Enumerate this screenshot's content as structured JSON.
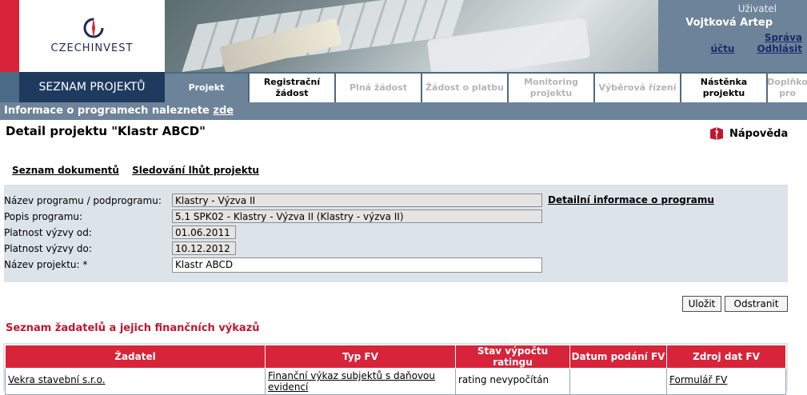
{
  "header": {
    "logo_text": "CZECHINVEST",
    "user_label": "Uživatel",
    "user_name": "Vojtková Artep",
    "account_link": "Správa účtu",
    "logout_link": "Odhlásit"
  },
  "nav": {
    "main": "SEZNAM PROJEKTŮ",
    "tabs": [
      {
        "label": "Projekt"
      },
      {
        "label": "Registrační žádost"
      },
      {
        "label": "Plná žádost"
      },
      {
        "label": "Žádost o platbu"
      },
      {
        "label": "Monitoring projektu"
      },
      {
        "label": "Výběrová řízení"
      },
      {
        "label": "Nástěnka projektu"
      },
      {
        "label": "Doplňko pro"
      }
    ]
  },
  "info_bar": {
    "text": "Informace o programech naleznete ",
    "link": "zde"
  },
  "page": {
    "title": "Detail projektu  \"Klastr ABCD\"",
    "help": "Nápověda",
    "sublinks": [
      "Seznam dokumentů",
      "Sledování lhůt projektu"
    ]
  },
  "form": {
    "program_label": "Název programu / podprogramu:",
    "program_value": "Klastry - Výzva II",
    "detail_link": "Detailní informace o programu",
    "desc_label": "Popis programu:",
    "desc_value": "5.1 SPK02 - Klastry - Výzva II (Klastry - výzva II)",
    "valid_from_label": "Platnost výzvy od:",
    "valid_from_value": "01.06.2011",
    "valid_to_label": "Platnost výzvy do:",
    "valid_to_value": "10.12.2012",
    "project_label": "Název projektu: *",
    "project_value": "Klastr ABCD"
  },
  "buttons": {
    "save": "Uložit",
    "remove": "Odstranit"
  },
  "applicants": {
    "title": "Seznam žadatelů a jejich finančních výkazů",
    "columns": [
      "Žadatel",
      "Typ FV",
      "Stav výpočtu ratingu",
      "Datum podání FV",
      "Zdroj dat FV"
    ],
    "rows": [
      {
        "applicant": "Vekra stavební s.r.o.",
        "type": "Finanční výkaz subjektů s daňovou evidencí",
        "status": "rating nevypočítán",
        "date": "",
        "source": "Formulář FV"
      }
    ]
  },
  "colors": {
    "brand_red": "#d7243a",
    "nav_dark": "#1e3a5e",
    "nav_blue": "#4a6a85",
    "panel": "#dce4ea"
  }
}
